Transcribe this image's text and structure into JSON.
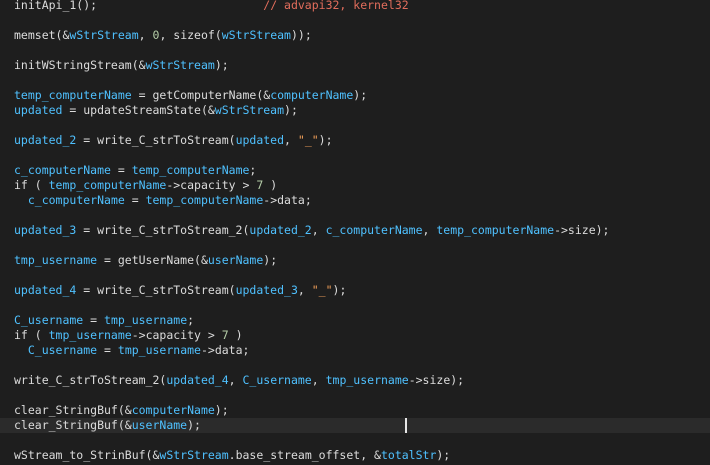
{
  "colors": {
    "background": "#1e1e1e",
    "current_line": "#2b2b2b",
    "plain": "#dcdcdc",
    "variable": "#4fc1ff",
    "number": "#b5cea8",
    "string": "#f5a25a",
    "comment": "#e26d5c"
  },
  "lines": [
    {
      "tokens": [
        {
          "t": "initApi_1();",
          "k": "plain"
        },
        {
          "t": "                        ",
          "k": "plain"
        },
        {
          "t": "// advapi32, kernel32",
          "k": "com"
        }
      ]
    },
    {
      "tokens": []
    },
    {
      "tokens": [
        {
          "t": "memset(&",
          "k": "plain"
        },
        {
          "t": "wStrStream",
          "k": "var"
        },
        {
          "t": ", ",
          "k": "plain"
        },
        {
          "t": "0",
          "k": "num"
        },
        {
          "t": ", sizeof(",
          "k": "plain"
        },
        {
          "t": "wStrStream",
          "k": "var"
        },
        {
          "t": "));",
          "k": "plain"
        }
      ]
    },
    {
      "tokens": []
    },
    {
      "tokens": [
        {
          "t": "initWStringStream(&",
          "k": "plain"
        },
        {
          "t": "wStrStream",
          "k": "var"
        },
        {
          "t": ");",
          "k": "plain"
        }
      ]
    },
    {
      "tokens": []
    },
    {
      "tokens": [
        {
          "t": "temp_computerName",
          "k": "var"
        },
        {
          "t": " = getComputerName(&",
          "k": "plain"
        },
        {
          "t": "computerName",
          "k": "var"
        },
        {
          "t": ");",
          "k": "plain"
        }
      ]
    },
    {
      "tokens": [
        {
          "t": "updated",
          "k": "var"
        },
        {
          "t": " = updateStreamState(&",
          "k": "plain"
        },
        {
          "t": "wStrStream",
          "k": "var"
        },
        {
          "t": ");",
          "k": "plain"
        }
      ]
    },
    {
      "tokens": []
    },
    {
      "tokens": [
        {
          "t": "updated_2",
          "k": "var"
        },
        {
          "t": " = write_C_strToStream(",
          "k": "plain"
        },
        {
          "t": "updated",
          "k": "var"
        },
        {
          "t": ", ",
          "k": "plain"
        },
        {
          "t": "\"_\"",
          "k": "str"
        },
        {
          "t": ");",
          "k": "plain"
        }
      ]
    },
    {
      "tokens": []
    },
    {
      "tokens": [
        {
          "t": "c_computerName",
          "k": "var"
        },
        {
          "t": " = ",
          "k": "plain"
        },
        {
          "t": "temp_computerName",
          "k": "var"
        },
        {
          "t": ";",
          "k": "plain"
        }
      ]
    },
    {
      "tokens": [
        {
          "t": "if ( ",
          "k": "plain"
        },
        {
          "t": "temp_computerName",
          "k": "var"
        },
        {
          "t": "->capacity > ",
          "k": "plain"
        },
        {
          "t": "7",
          "k": "num"
        },
        {
          "t": " )",
          "k": "plain"
        }
      ]
    },
    {
      "tokens": [
        {
          "t": "  ",
          "k": "plain"
        },
        {
          "t": "c_computerName",
          "k": "var"
        },
        {
          "t": " = ",
          "k": "plain"
        },
        {
          "t": "temp_computerName",
          "k": "var"
        },
        {
          "t": "->data;",
          "k": "plain"
        }
      ]
    },
    {
      "tokens": []
    },
    {
      "tokens": [
        {
          "t": "updated_3",
          "k": "var"
        },
        {
          "t": " = write_C_strToStream_2(",
          "k": "plain"
        },
        {
          "t": "updated_2",
          "k": "var"
        },
        {
          "t": ", ",
          "k": "plain"
        },
        {
          "t": "c_computerName",
          "k": "var"
        },
        {
          "t": ", ",
          "k": "plain"
        },
        {
          "t": "temp_computerName",
          "k": "var"
        },
        {
          "t": "->size);",
          "k": "plain"
        }
      ]
    },
    {
      "tokens": []
    },
    {
      "tokens": [
        {
          "t": "tmp_username",
          "k": "var"
        },
        {
          "t": " = getUserName(&",
          "k": "plain"
        },
        {
          "t": "userName",
          "k": "var"
        },
        {
          "t": ");",
          "k": "plain"
        }
      ]
    },
    {
      "tokens": []
    },
    {
      "tokens": [
        {
          "t": "updated_4",
          "k": "var"
        },
        {
          "t": " = write_C_strToStream(",
          "k": "plain"
        },
        {
          "t": "updated_3",
          "k": "var"
        },
        {
          "t": ", ",
          "k": "plain"
        },
        {
          "t": "\"_\"",
          "k": "str"
        },
        {
          "t": ");",
          "k": "plain"
        }
      ]
    },
    {
      "tokens": []
    },
    {
      "tokens": [
        {
          "t": "C_username",
          "k": "var"
        },
        {
          "t": " = ",
          "k": "plain"
        },
        {
          "t": "tmp_username",
          "k": "var"
        },
        {
          "t": ";",
          "k": "plain"
        }
      ]
    },
    {
      "tokens": [
        {
          "t": "if ( ",
          "k": "plain"
        },
        {
          "t": "tmp_username",
          "k": "var"
        },
        {
          "t": "->capacity > ",
          "k": "plain"
        },
        {
          "t": "7",
          "k": "num"
        },
        {
          "t": " )",
          "k": "plain"
        }
      ]
    },
    {
      "tokens": [
        {
          "t": "  ",
          "k": "plain"
        },
        {
          "t": "C_username",
          "k": "var"
        },
        {
          "t": " = ",
          "k": "plain"
        },
        {
          "t": "tmp_username",
          "k": "var"
        },
        {
          "t": "->data;",
          "k": "plain"
        }
      ]
    },
    {
      "tokens": []
    },
    {
      "tokens": [
        {
          "t": "write_C_strToStream_2(",
          "k": "plain"
        },
        {
          "t": "updated_4",
          "k": "var"
        },
        {
          "t": ", ",
          "k": "plain"
        },
        {
          "t": "C_username",
          "k": "var"
        },
        {
          "t": ", ",
          "k": "plain"
        },
        {
          "t": "tmp_username",
          "k": "var"
        },
        {
          "t": "->size);",
          "k": "plain"
        }
      ]
    },
    {
      "tokens": []
    },
    {
      "tokens": [
        {
          "t": "clear_StringBuf(&",
          "k": "plain"
        },
        {
          "t": "computerName",
          "k": "var"
        },
        {
          "t": ");",
          "k": "plain"
        }
      ]
    },
    {
      "tokens": [
        {
          "t": "clear_StringBuf(&",
          "k": "plain"
        },
        {
          "t": "userName",
          "k": "var"
        },
        {
          "t": ");",
          "k": "plain"
        }
      ]
    },
    {
      "tokens": []
    },
    {
      "tokens": [
        {
          "t": "wStream_to_StrinBuf(&",
          "k": "plain"
        },
        {
          "t": "wStrStream",
          "k": "var"
        },
        {
          "t": ".base_stream_offset, &",
          "k": "plain"
        },
        {
          "t": "totalStr",
          "k": "var"
        },
        {
          "t": ");",
          "k": "plain"
        }
      ]
    }
  ],
  "current_line_index": 28
}
